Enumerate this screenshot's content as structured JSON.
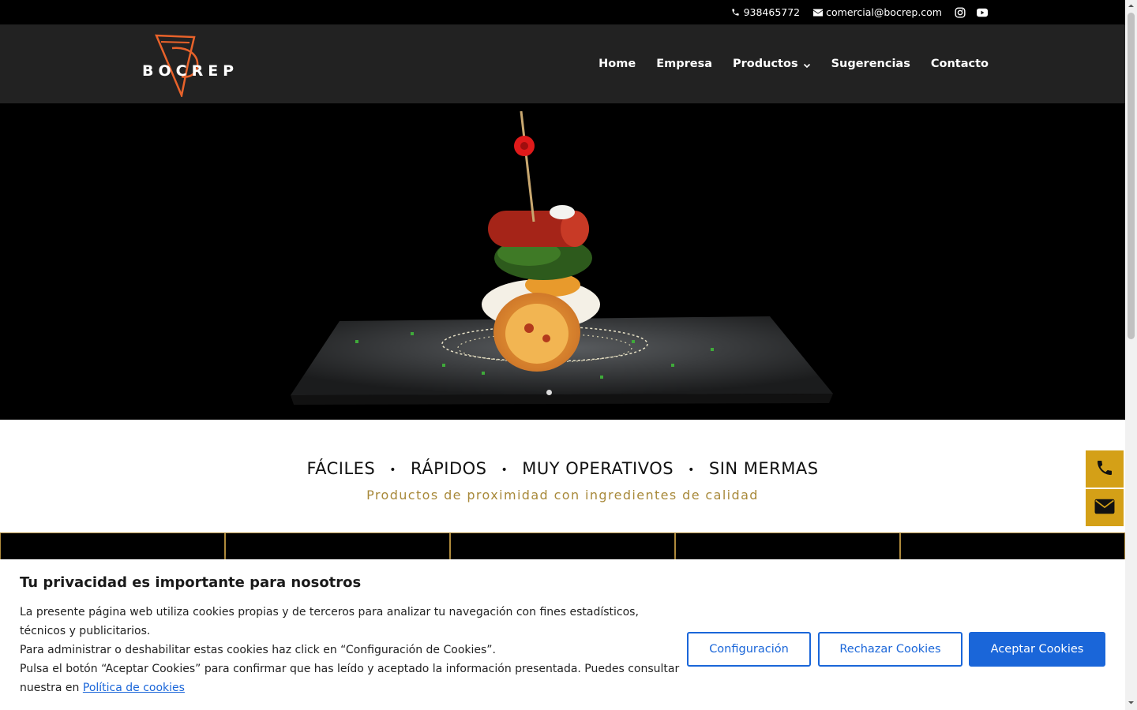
{
  "topbar": {
    "phone": "938465772",
    "email": "comercial@bocrep.com",
    "social": [
      "instagram-icon",
      "youtube-icon"
    ]
  },
  "header": {
    "logo_text": "BOCREP",
    "nav": [
      {
        "label": "Home"
      },
      {
        "label": "Empresa"
      },
      {
        "label": "Productos",
        "has_dropdown": true
      },
      {
        "label": "Sugerencias"
      },
      {
        "label": "Contacto"
      }
    ]
  },
  "features": {
    "items": [
      "FÁCILES",
      "RÁPIDOS",
      "MUY OPERATIVOS",
      "SIN MERMAS"
    ],
    "separator": "•",
    "tagline": "Productos de proximidad con ingredientes de calidad"
  },
  "float_buttons": [
    "phone-icon",
    "envelope-icon"
  ],
  "cookie": {
    "title": "Tu privacidad es importante para nosotros",
    "p1": "La presente página web utiliza cookies propias y de terceros para analizar tu navegación con fines estadísticos, técnicos y publicitarios.",
    "p2": "Para administrar o deshabilitar estas cookies haz click en “Configuración de Cookies”.",
    "p3": "Pulsa el botón “Aceptar Cookies” para confirmar que has leído y aceptado la información presentada. Puedes consultar nuestra en",
    "link": "Política de cookies",
    "btn_config": "Configuración",
    "btn_reject": "Rechazar Cookies",
    "btn_accept": "Aceptar Cookies"
  },
  "colors": {
    "accent_gold": "#d4a017",
    "tagline_gold": "#a8893a",
    "cookie_blue": "#1a66d9",
    "logo_orange": "#e8622a"
  }
}
